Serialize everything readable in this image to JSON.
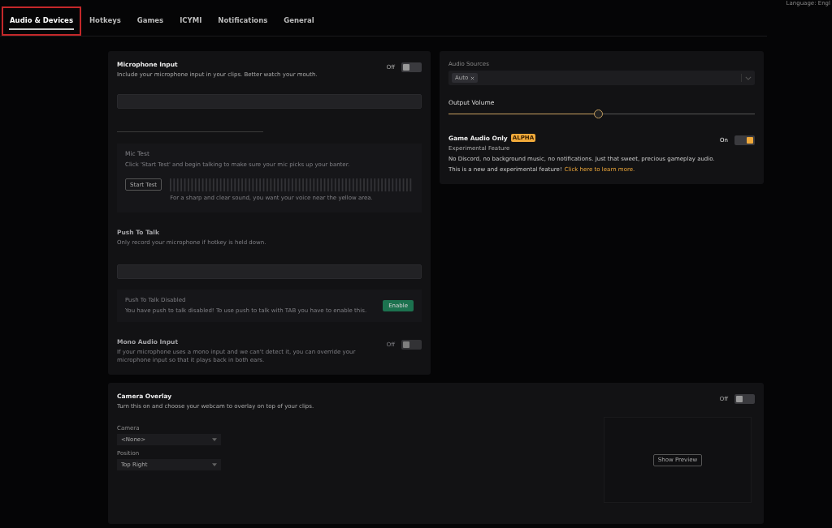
{
  "tabs": [
    {
      "label": "Audio & Devices",
      "selected": true
    },
    {
      "label": "Hotkeys",
      "selected": false
    },
    {
      "label": "Games",
      "selected": false
    },
    {
      "label": "ICYMI",
      "selected": false
    },
    {
      "label": "Notifications",
      "selected": false
    },
    {
      "label": "General",
      "selected": false
    }
  ],
  "language_label": "Language: Engl",
  "microphone": {
    "title": "Microphone Input",
    "description": "Include your microphone input in your clips. Better watch your mouth.",
    "toggle_label": "Off",
    "on": false,
    "mic_test": {
      "title": "Mic Test",
      "description": "Click 'Start Test' and begin talking to make sure your mic picks up your banter.",
      "button": "Start Test",
      "hint": "For a sharp and clear sound, you want your voice near the yellow area."
    },
    "push_to_talk": {
      "title": "Push To Talk",
      "description": "Only record your microphone if hotkey is held down.",
      "notice_title": "Push To Talk Disabled",
      "notice_text": "You have push to talk disabled! To use push to talk with TAB you have to enable this.",
      "button": "Enable"
    },
    "mono": {
      "title": "Mono Audio Input",
      "description": "If your microphone uses a mono input and we can't detect it, you can override your microphone input so that it plays back in both ears.",
      "toggle_label": "Off",
      "on": false
    }
  },
  "audio": {
    "sources_label": "Audio Sources",
    "sources": [
      "Auto"
    ],
    "volume_label": "Output Volume",
    "volume": {
      "level": 0.49
    },
    "game_audio": {
      "title": "Game Audio Only",
      "badge": "ALPHA",
      "subtitle": "Experimental Feature",
      "toggle_label": "On",
      "on": true,
      "description": "No Discord, no background music, no notifications. Just that sweet, precious gameplay audio.",
      "note": "This is a new and experimental feature!",
      "link": "Click here to learn more."
    }
  },
  "camera": {
    "title": "Camera Overlay",
    "description": "Turn this on and choose your webcam to overlay on top of your clips.",
    "toggle_label": "Off",
    "on": false,
    "fields": [
      {
        "label": "Camera",
        "value": "<None>"
      },
      {
        "label": "Position",
        "value": "Top Right"
      }
    ],
    "preview_button": "Show Preview"
  }
}
